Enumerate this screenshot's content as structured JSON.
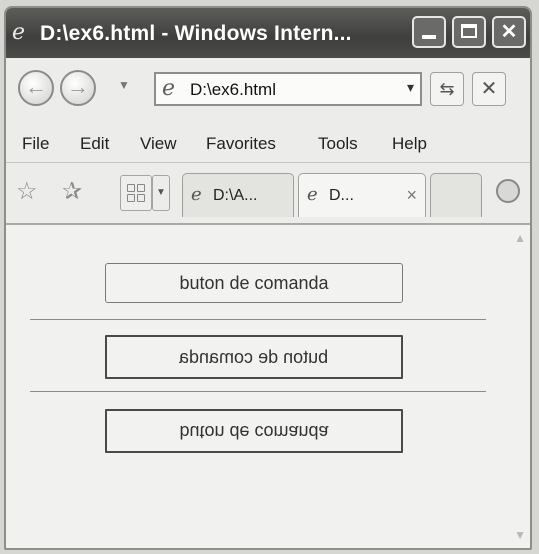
{
  "window": {
    "title": "D:\\ex6.html - Windows Intern...",
    "title_icon": "ie-logo-icon"
  },
  "navigation": {
    "address": "D:\\ex6.html",
    "back_icon": "back-arrow-icon",
    "forward_icon": "forward-arrow-icon",
    "refresh_icon": "refresh-icon",
    "stop_icon": "stop-icon"
  },
  "menu": {
    "file": "File",
    "edit": "Edit",
    "view": "View",
    "favorites": "Favorites",
    "tools": "Tools",
    "help": "Help"
  },
  "tabs": [
    {
      "label": "D:\\A...",
      "active": false
    },
    {
      "label": "D...",
      "active": true,
      "close": "×"
    },
    {
      "label": "",
      "active": false
    }
  ],
  "page": {
    "buttons": [
      {
        "label": "buton de comanda",
        "transform": "none"
      },
      {
        "label": "buton de comanda",
        "transform": "mirror-horizontal"
      },
      {
        "label": "buton de comanda",
        "transform": "mirror-vertical"
      }
    ]
  },
  "colors": {
    "titlebar": "#4a4a48",
    "content_bg": "#f1f1ef",
    "button_border": "#4a4a48"
  }
}
